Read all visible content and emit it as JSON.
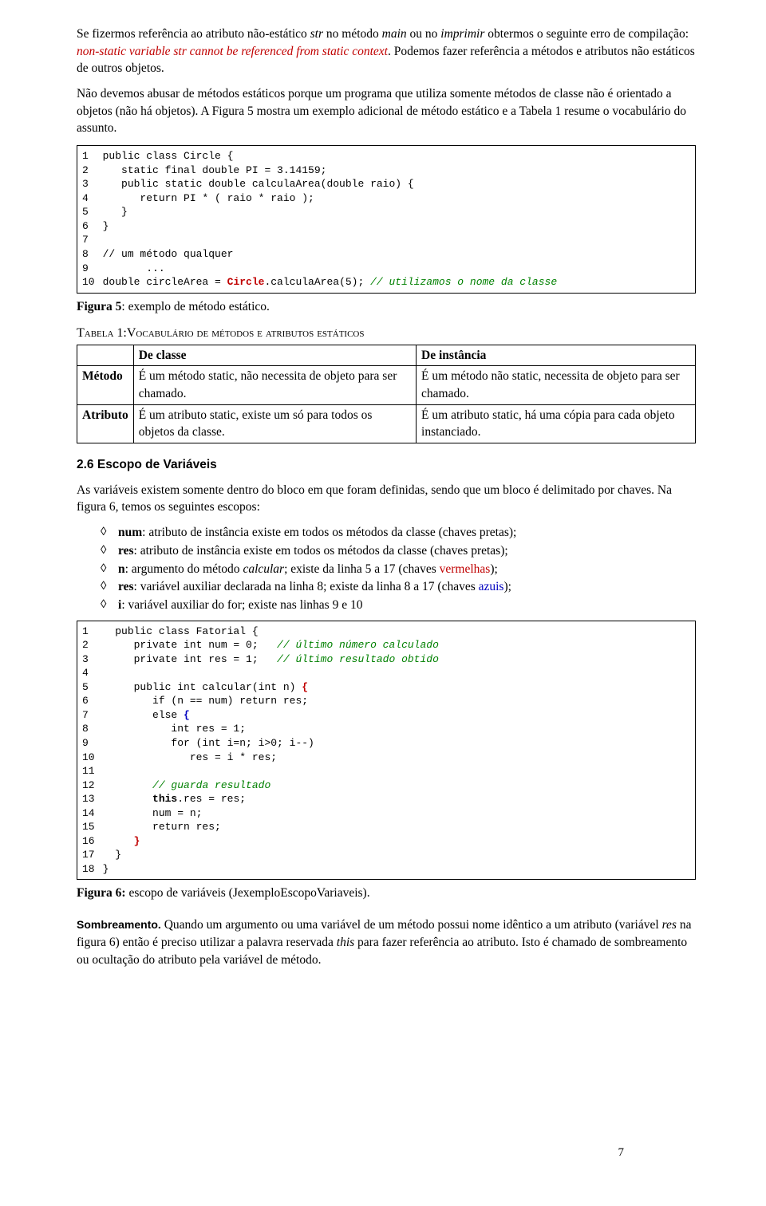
{
  "p1a": "Se fizermos referência ao atributo não-estático ",
  "p1b": "str",
  "p1c": " no método ",
  "p1d": "main",
  "p1e": " ou no ",
  "p1f": "imprimir",
  "p1g": " obtermos o seguinte erro de compilação: ",
  "p1err": "non-static variable str cannot be referenced from static context",
  "p1h": ". Podemos fazer referência a métodos e atributos não estáticos de outros objetos.",
  "p2": "Não devemos abusar de métodos estáticos porque um programa que utiliza somente métodos de classe não é orientado a objetos (não há objetos). A Figura 5 mostra um exemplo adicional de método estático e a Tabela 1 resume o vocabulário do assunto.",
  "code1_lnums": "1\n2\n3\n4\n5\n6\n7\n8\n9\n10",
  "code1_l1": "public class Circle {",
  "code1_l2": "   static final double PI = 3.14159;",
  "code1_l3": "   public static double calculaArea(double raio) {",
  "code1_l4": "      return PI * ( raio * raio );",
  "code1_l5": "   }",
  "code1_l6": "}",
  "code1_l7": "",
  "code1_l8": "// um método qualquer",
  "code1_l9": "       ...",
  "code1_l10a": "double circleArea = ",
  "code1_l10b": "Circle",
  "code1_l10c": ".calculaArea(5); ",
  "code1_l10d": "// utilizamos o nome da classe",
  "fig5a": "Figura 5",
  "fig5b": ": exemplo de método estático.",
  "tab1caption": "Tabela 1:Vocabulário de métodos e atributos estáticos",
  "th_classe": "De classe",
  "th_inst": "De instância",
  "row_metodo": "Método",
  "cell_m1": "É um método static, não necessita de objeto para ser chamado.",
  "cell_m2": "É um método não static, necessita de objeto para ser chamado.",
  "row_attr": "Atributo",
  "cell_a1": "É um atributo static, existe um só para todos os objetos da classe.",
  "cell_a2": "É um atributo static, há uma cópia para cada objeto instanciado.",
  "sec26": "2.6   Escopo de Variáveis",
  "p3": "As variáveis existem somente dentro do bloco em que foram definidas, sendo que um bloco é delimitado por chaves. Na figura 6, temos os seguintes escopos:",
  "li1a": "num",
  "li1b": ": atributo de instância existe em todos os métodos da classe (chaves pretas);",
  "li2a": "res",
  "li2b": ": atributo de instância existe em todos os métodos da classe (chaves pretas);",
  "li3a": "n",
  "li3b": ": argumento do método ",
  "li3c": "calcular",
  "li3d": "; existe da linha 5 a 17 (chaves ",
  "li3e": "vermelhas",
  "li3f": ");",
  "li4a": "res",
  "li4b": ": variável auxiliar declarada na linha 8; existe da linha 8 a 17 (chaves ",
  "li4c": "azuis",
  "li4d": ");",
  "li5a": "i",
  "li5b": ": variável auxiliar do for; existe nas linhas 9 e 10",
  "code2_lnums": "1\n2\n3\n4\n5\n6\n7\n8\n9\n10\n11\n12\n13\n14\n15\n16\n17\n18",
  "c2_l1": "  public class Fatorial {",
  "c2_l2a": "     private int num = 0;   ",
  "c2_l2b": "// último número calculado",
  "c2_l3a": "     private int res = 1;   ",
  "c2_l3b": "// último resultado obtido",
  "c2_l4": "",
  "c2_l5a": "     public int calcular(int n) ",
  "c2_l5b": "{",
  "c2_l6": "        if (n == num) return res;",
  "c2_l7a": "        else ",
  "c2_l7b": "{",
  "c2_l8": "           int res = 1;",
  "c2_l9": "           for (int i=n; i>0; i--)",
  "c2_l10": "              res = i * res;",
  "c2_l11": "",
  "c2_l12a": "        ",
  "c2_l12b": "// guarda resultado",
  "c2_l13a": "        ",
  "c2_l13b": "this",
  "c2_l13c": ".res = res;",
  "c2_l14": "        num = n;",
  "c2_l15": "        return res;",
  "c2_l16": "     }",
  "c2_l17": "  }",
  "c2_l18": "}",
  "fig6a": "Figura 6:",
  "fig6b": " escopo de variáveis (JexemploEscopoVariaveis).",
  "sombr_lead": "Sombreamento.",
  "sombr_txt_a": " Quando um argumento ou uma variável de um método possui nome idêntico a um atributo (variável ",
  "sombr_txt_b": "res",
  "sombr_txt_c": " na figura 6) então é preciso utilizar a palavra reservada ",
  "sombr_txt_d": "this",
  "sombr_txt_e": " para fazer referência ao atributo. Isto é chamado de sombreamento ou ocultação do atributo pela variável de método.",
  "pagenum": "7"
}
